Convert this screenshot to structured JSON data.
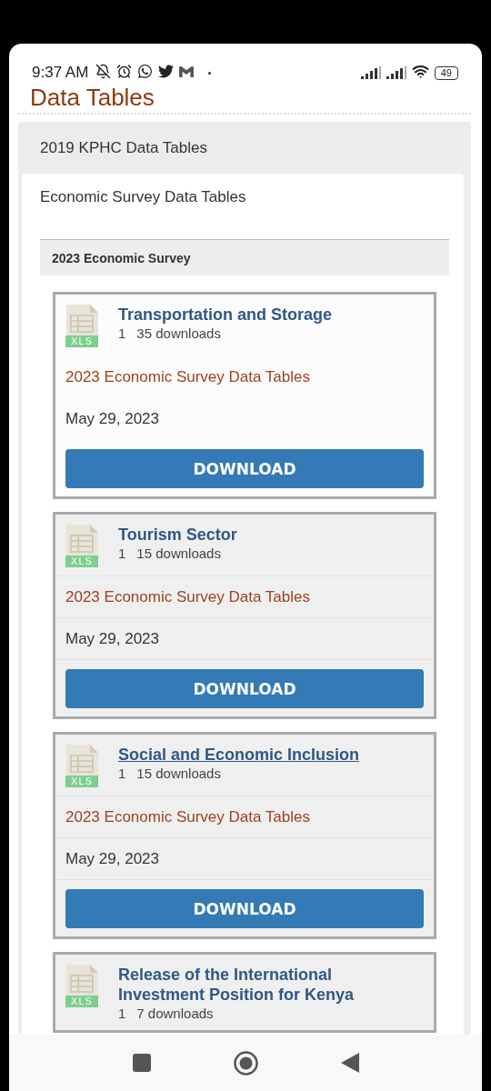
{
  "status_bar": {
    "time": "9:37 AM",
    "battery": "49"
  },
  "page_title": "Data Tables",
  "accordion": [
    {
      "label": "2019 KPHC Data Tables",
      "expanded": false
    },
    {
      "label": "Economic Survey Data Tables",
      "expanded": true
    }
  ],
  "section": {
    "title": "2023 Economic Survey"
  },
  "documents": [
    {
      "file_type": "XLS",
      "title": "Transportation and Storage",
      "count": "1",
      "downloads": "35 downloads",
      "category": "2023 Economic Survey Data Tables",
      "date": "May 29, 2023",
      "button": "DOWNLOAD",
      "active": true,
      "title_hovered": false
    },
    {
      "file_type": "XLS",
      "title": "Tourism Sector",
      "count": "1",
      "downloads": "15 downloads",
      "category": "2023 Economic Survey Data Tables",
      "date": "May 29, 2023",
      "button": "DOWNLOAD",
      "active": false,
      "title_hovered": false
    },
    {
      "file_type": "XLS",
      "title": "Social and Economic Inclusion",
      "count": "1",
      "downloads": "15 downloads",
      "category": "2023 Economic Survey Data Tables",
      "date": "May 29, 2023",
      "button": "DOWNLOAD",
      "active": false,
      "title_hovered": true
    },
    {
      "file_type": "XLS",
      "title": "Release of the International Investment Position for Kenya",
      "count": "1",
      "downloads": "7 downloads",
      "active": false,
      "title_hovered": false
    }
  ]
}
